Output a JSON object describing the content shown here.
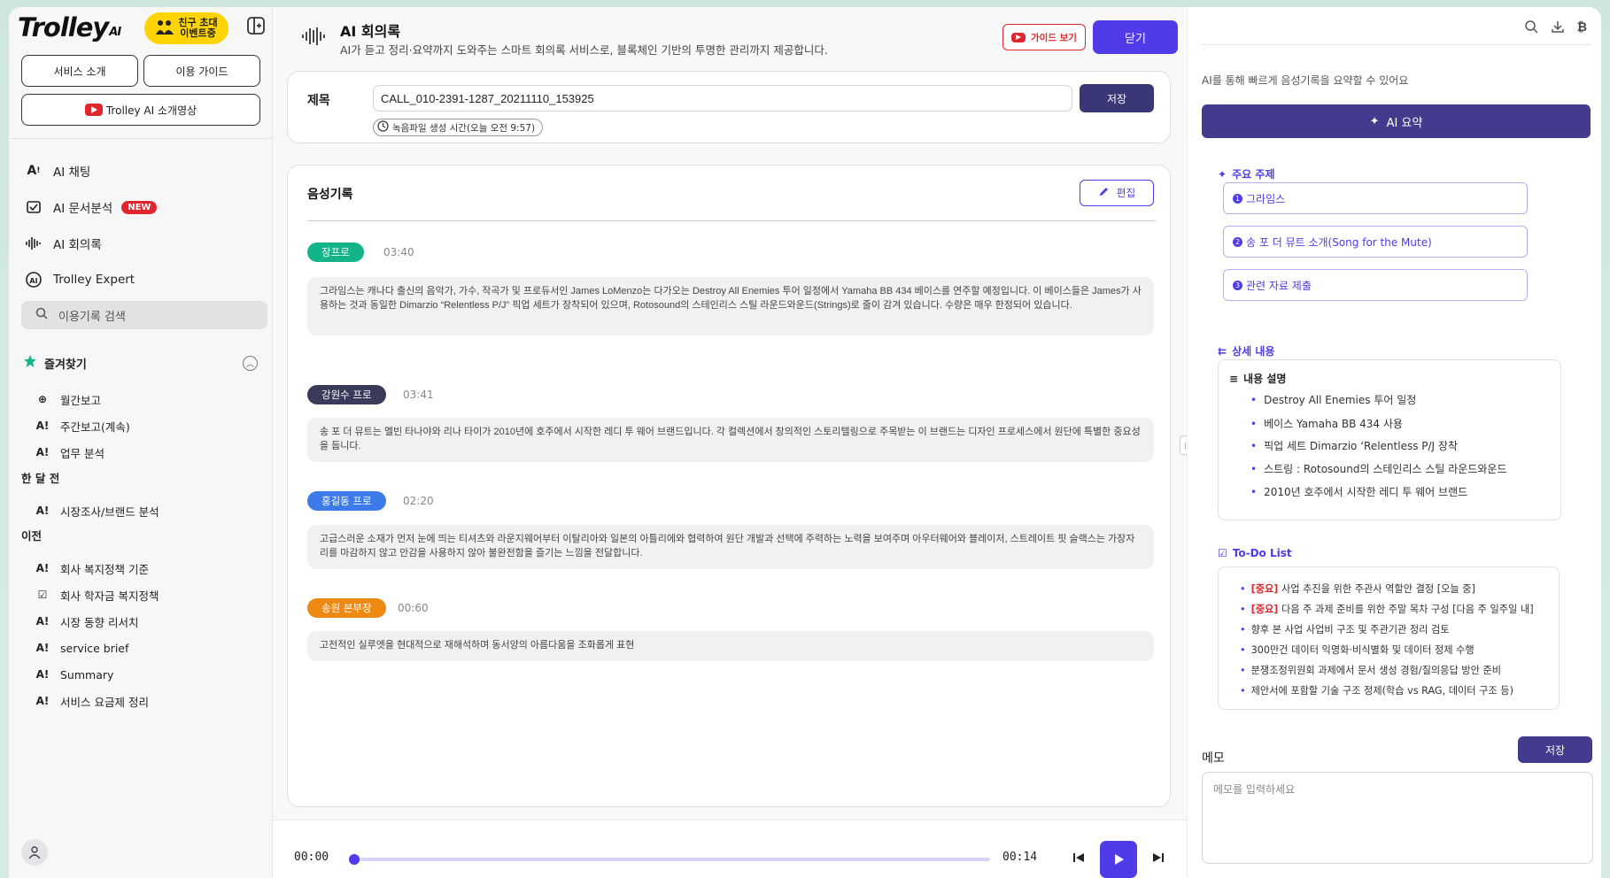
{
  "sidebar": {
    "logo_text": "Trolley",
    "logo_sub": "AI",
    "event_badge": "친구 초대\n이벤트중",
    "btn_service_intro": "서비스 소개",
    "btn_usage_guide": "이용 가이드",
    "btn_video": "Trolley AI 소개영상",
    "nav": [
      {
        "label": "AI 채팅",
        "icon": "ai-chat-icon"
      },
      {
        "label": "AI 문서분석",
        "icon": "document-analysis-icon",
        "badge": "NEW"
      },
      {
        "label": "AI 회의록",
        "icon": "waveform-icon"
      },
      {
        "label": "Trolley Expert",
        "icon": "expert-icon"
      }
    ],
    "search_placeholder": "이용기록 검색",
    "favorites_title": "즐겨찾기",
    "favorites": [
      {
        "label": "월간보고",
        "icon": "search-report-icon"
      },
      {
        "label": "주간보고(계속)",
        "icon": "ai-icon"
      },
      {
        "label": "업무 분석",
        "icon": "ai-icon"
      }
    ],
    "group_month": "한 달 전",
    "month_items": [
      {
        "label": "시장조사/브랜드 분석",
        "icon": "ai-icon"
      }
    ],
    "group_before": "이전",
    "before_items": [
      {
        "label": "회사 복지정책 기준",
        "icon": "ai-icon"
      },
      {
        "label": "회사 학자금 복지정책",
        "icon": "document-icon"
      },
      {
        "label": "시장 동향 리서치",
        "icon": "ai-icon"
      },
      {
        "label": "service brief",
        "icon": "ai-icon"
      },
      {
        "label": "Summary",
        "icon": "ai-icon"
      },
      {
        "label": "서비스 요금제 정리",
        "icon": "ai-icon"
      }
    ]
  },
  "header": {
    "title": "AI 회의록",
    "subtitle": "AI가 듣고 정리·요약까지 도와주는 스마트 회의록 서비스로, 블록체인 기반의 투명한 관리까지 제공합니다.",
    "guide_label": "가이드 보기",
    "close_label": "닫기"
  },
  "title_card": {
    "label": "제목",
    "value": "CALL_010-2391-1287_20211110_153925",
    "save_label": "저장",
    "created": "녹음파일 생성 시간(오늘 오전 9:57)"
  },
  "record": {
    "title": "음성기록",
    "edit_label": "편집",
    "entries": [
      {
        "speaker": "장프로",
        "time": "03:40",
        "color": "#14b48a",
        "text": "그라임스는 캐나다 출신의 음악가, 가수, 작곡가 및 프로듀서인 James LoMenzo는 다가오는 Destroy All Enemies 투어 일정에서 Yamaha BB 434 베이스를 연주할 예정입니다. 이 베이스들은 James가 사용하는 것과 동일한 Dimarzio “Relentless P/J” 픽업 세트가 장착되어 있으며, Rotosound의 스테인리스 스틸 라운드와운드(Strings)로 줄이 감겨 있습니다. 수량은 매우 한정되어 있습니다."
      },
      {
        "speaker": "강원수 프로",
        "time": "03:41",
        "color": "#3a3a5a",
        "text": "송 포 더 뮤트는 멜빈 타나야와 리나 타이가 2010년에 호주에서 시작한 레디 투 웨어 브랜드입니다. 각 컬렉션에서 창의적인 스토리텔링으로 주목받는 이 브랜드는 디자인 프로세스에서 원단에 특별한 중요성을 둡니다."
      },
      {
        "speaker": "홍길동 프로",
        "time": "02:20",
        "color": "#3d7bea",
        "text": "고급스러운 소재가 먼저 눈에 띄는 티셔츠와 라운지웨어부터 이탈리아와 일본의 아틀리에와 협력하여 원단 개발과 선택에 주력하는 노력을 보여주며 아우터웨어와 블레이저, 스트레이트 핏 슬랙스는 가장자리를 마감하지 않고 안감을 사용하지 않아 불완전함을 즐기는 느낌을 전달합니다."
      },
      {
        "speaker": "송원 본부장",
        "time": "00:60",
        "color": "#ee8a12",
        "text": "고전적인 실루엣을 현대적으로 재해석하며 동서양의 아름다움을 조화롭게 표현"
      }
    ]
  },
  "player": {
    "current": "00:00",
    "total": "00:14",
    "progress": 0
  },
  "right": {
    "hint": "AI를 통해 빠르게 음성기록을 요약할 수 있어요",
    "ai_summary_label": "AI 요약",
    "topics_title": "주요 주제",
    "topics": [
      {
        "num": "1",
        "label": "그라임스"
      },
      {
        "num": "2",
        "label": "송 포 더 뮤트 소개(Song for the Mute)"
      },
      {
        "num": "3",
        "label": "관련 자료 제출"
      }
    ],
    "detail_title": "상세 내용",
    "detail_box_title": "내용 설명",
    "details": [
      "Destroy All Enemies 투어 일정",
      "베이스 Yamaha BB 434 사용",
      "픽업 세트 Dimarzio ‘Relentless P/J 장착",
      "스트링 : Rotosound의 스테인리스 스틸 라운드와운드",
      "2010년 호주에서 시작한 레디 투 웨어 브랜드"
    ],
    "todo_title": "To-Do List",
    "todos": [
      {
        "imp": "[중요]",
        "text": "사업 추진을 위한 주관사 역할안 결정 [오늘 중]"
      },
      {
        "imp": "[중요]",
        "text": "다음 주 과제 준비를 위한 주말 목차 구성 [다음 주 일주일 내]"
      },
      {
        "imp": "",
        "text": "향후 본 사업 사업비 구조 및 주관기관 정리 검토"
      },
      {
        "imp": "",
        "text": "300만건 데이터 익명화·비식별화 및 데이터 정제 수행"
      },
      {
        "imp": "",
        "text": "분쟁조정위원회 과제에서 문서 생성 경험/질의응답 방안 준비"
      },
      {
        "imp": "",
        "text": "제안서에 포함할 기술 구조 정제(학습 vs RAG, 데이터 구조 등)"
      }
    ],
    "memo_label": "메모",
    "memo_save": "저장",
    "memo_placeholder": "메모를 입력하세요"
  }
}
